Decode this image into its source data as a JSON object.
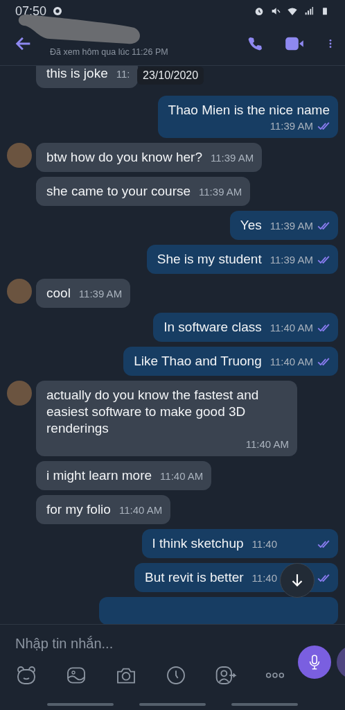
{
  "status_bar": {
    "time": "07:50"
  },
  "header": {
    "seen": "Đã xem hôm qua lúc 11:26 PM"
  },
  "date_chip": "23/10/2020",
  "messages": [
    {
      "kind": "in",
      "avatar": false,
      "text": "this is joke",
      "time": "11:"
    },
    {
      "kind": "out",
      "text": "Thao Mien is the nice name",
      "time": "11:39 AM",
      "read": true,
      "stacked": true
    },
    {
      "kind": "in",
      "avatar": true,
      "text": "btw how do you know her?",
      "time": "11:39 AM"
    },
    {
      "kind": "in",
      "avatar": false,
      "text": "she came to your course",
      "time": "11:39 AM"
    },
    {
      "kind": "out",
      "text": "Yes",
      "time": "11:39 AM",
      "read": true
    },
    {
      "kind": "out",
      "text": "She is my student",
      "time": "11:39 AM",
      "read": true
    },
    {
      "kind": "in",
      "avatar": true,
      "text": "cool",
      "time": "11:39 AM"
    },
    {
      "kind": "out",
      "text": "In software class",
      "time": "11:40 AM",
      "read": true
    },
    {
      "kind": "out",
      "text": "Like Thao and Truong",
      "time": "11:40 AM",
      "read": true
    },
    {
      "kind": "in",
      "avatar": true,
      "text": "actually do you know the fastest and easiest software to make good 3D renderings",
      "time": "11:40 AM",
      "stacked": true
    },
    {
      "kind": "in",
      "avatar": false,
      "text": "i might  learn more",
      "time": "11:40 AM"
    },
    {
      "kind": "in",
      "avatar": false,
      "text": "for my folio",
      "time": "11:40 AM"
    },
    {
      "kind": "out",
      "text": "I think sketchup",
      "time": "11:40",
      "read": true
    },
    {
      "kind": "out",
      "text": "But revit is better",
      "time": "11:40",
      "read": true
    },
    {
      "kind": "out_partial"
    }
  ],
  "composer": {
    "placeholder": "Nhập tin nhắn..."
  }
}
